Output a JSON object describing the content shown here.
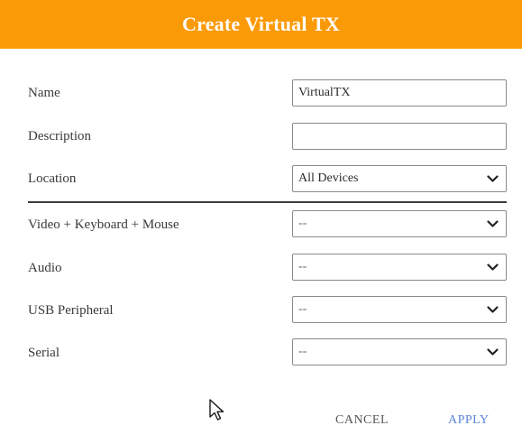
{
  "dialog": {
    "title": "Create Virtual TX",
    "header_color": "#fb9a07"
  },
  "fields": {
    "name": {
      "label": "Name",
      "value": "VirtualTX"
    },
    "description": {
      "label": "Description",
      "value": ""
    },
    "location": {
      "label": "Location",
      "value": "All Devices"
    },
    "video_keyboard_mouse": {
      "label": "Video + Keyboard + Mouse",
      "value": "--"
    },
    "audio": {
      "label": "Audio",
      "value": "--"
    },
    "usb_peripheral": {
      "label": "USB Peripheral",
      "value": "--"
    },
    "serial": {
      "label": "Serial",
      "value": "--"
    }
  },
  "actions": {
    "cancel_label": "CANCEL",
    "apply_label": "APPLY",
    "apply_color": "#5b86d6"
  },
  "icons": {
    "dropdown": "chevron-down-icon",
    "cursor": "mouse-pointer-icon"
  }
}
